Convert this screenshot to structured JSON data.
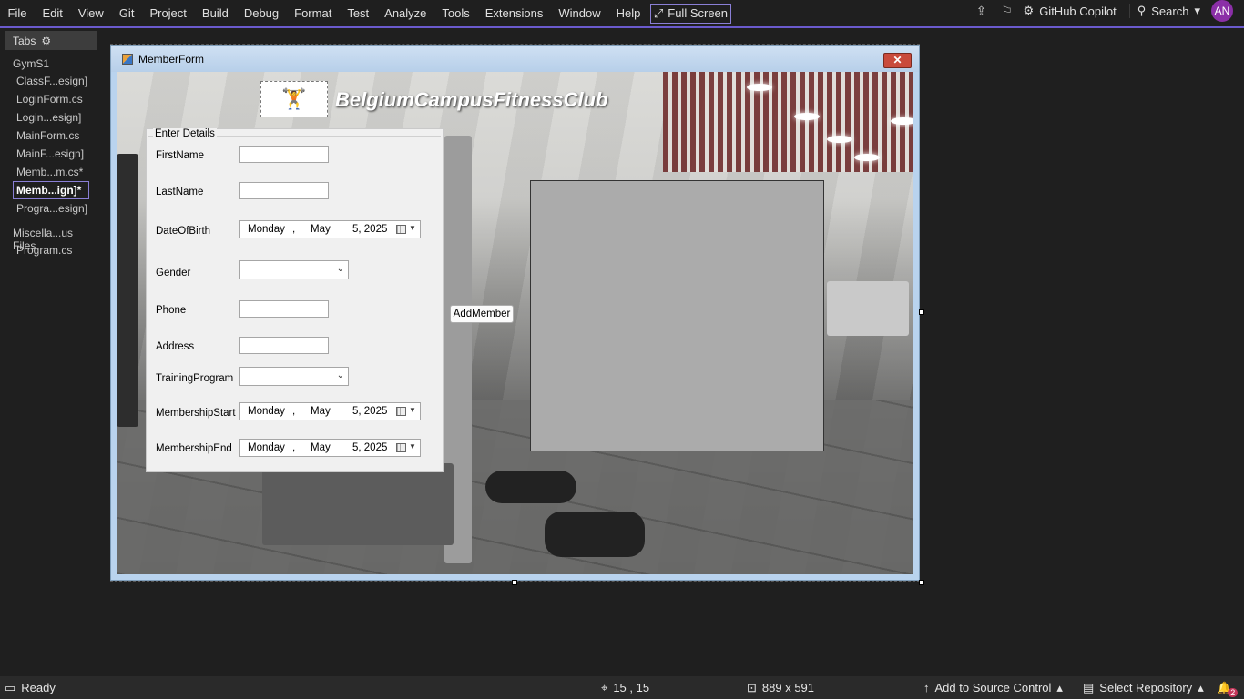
{
  "menu": {
    "items": [
      "File",
      "Edit",
      "View",
      "Git",
      "Project",
      "Build",
      "Debug",
      "Format",
      "Test",
      "Analyze",
      "Tools",
      "Extensions",
      "Window",
      "Help"
    ],
    "fullscreen_label": "Full Screen",
    "copilot_label": "GitHub Copilot",
    "search_label": "Search",
    "avatar_initials": "AN"
  },
  "tabs": {
    "header": "Tabs",
    "group1": "GymS1",
    "files1": [
      "ClassF...esign]",
      "LoginForm.cs",
      "Login...esign]",
      "MainForm.cs",
      "MainF...esign]",
      "Memb...m.cs*",
      "Memb...ign]*",
      "Progra...esign]"
    ],
    "active_index": 6,
    "group2": "Miscella...us Files",
    "files2": [
      "Program.cs"
    ]
  },
  "form": {
    "title": "MemberForm",
    "close_glyph": "✕",
    "app_title": "BelgiumCampusFitnessClub",
    "groupbox_title": "Enter Details",
    "labels": {
      "first_name": "FirstName",
      "last_name": "LastName",
      "dob": "DateOfBirth",
      "gender": "Gender",
      "phone": "Phone",
      "address": "Address",
      "training": "TrainingProgram",
      "mstart": "MembershipStart",
      "mend": "MembershipEnd"
    },
    "date": {
      "day": "Monday",
      "comma": ",",
      "month": "May",
      "date": "5, 2025"
    },
    "add_button": "AddMember"
  },
  "status": {
    "ready": "Ready",
    "position": "15 , 15",
    "size": "889 x 591",
    "source_control": "Add to Source Control",
    "repository": "Select Repository",
    "notifications": "2"
  },
  "colors": {
    "accent": "#6a5acd",
    "avatar": "#8b2fa7",
    "close": "#c94b3c"
  }
}
